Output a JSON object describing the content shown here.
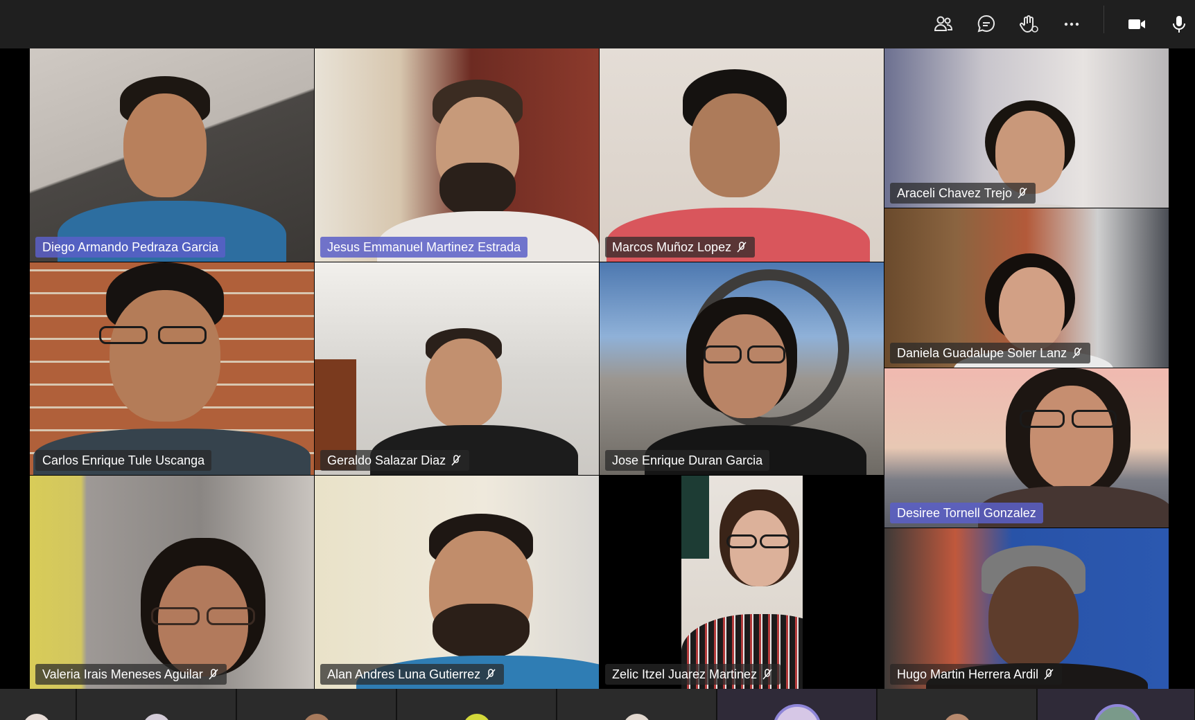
{
  "toolbar": {
    "participants_icon": "people-icon",
    "chat_icon": "chat-bubble-icon",
    "reactions_icon": "raise-hand-icon",
    "more_icon": "ellipsis-icon",
    "camera_icon": "video-camera-icon",
    "mic_icon": "microphone-icon"
  },
  "colors": {
    "toolbar_bg": "#1f1f1f",
    "name_tag_bg": "#282828",
    "pinned_tag_bg": "#5a5fc8",
    "stage_bg": "#000000"
  },
  "participants": [
    {
      "name": "Diego Armando Pedraza Garcia",
      "muted": false,
      "pinned": true
    },
    {
      "name": "Jesus Emmanuel Martinez Estrada",
      "muted": false,
      "pinned": true
    },
    {
      "name": "Marcos Muñoz Lopez",
      "muted": true,
      "pinned": false
    },
    {
      "name": "Araceli Chavez Trejo",
      "muted": true,
      "pinned": false
    },
    {
      "name": "Carlos Enrique Tule Uscanga",
      "muted": false,
      "pinned": false
    },
    {
      "name": "Geraldo Salazar Diaz",
      "muted": true,
      "pinned": false
    },
    {
      "name": "Jose Enrique Duran Garcia",
      "muted": false,
      "pinned": false
    },
    {
      "name": "Daniela Guadalupe Soler Lanz",
      "muted": true,
      "pinned": false
    },
    {
      "name": "Desiree Tornell Gonzalez",
      "muted": false,
      "pinned": true
    },
    {
      "name": "Valeria Irais Meneses Aguilar",
      "muted": true,
      "pinned": false
    },
    {
      "name": "Alan Andres Luna Gutierrez",
      "muted": true,
      "pinned": false
    },
    {
      "name": "Zelic Itzel Juarez Martinez",
      "muted": true,
      "pinned": false
    },
    {
      "name": "Hugo Martin Herrera Ardil",
      "muted": true,
      "pinned": false
    }
  ]
}
